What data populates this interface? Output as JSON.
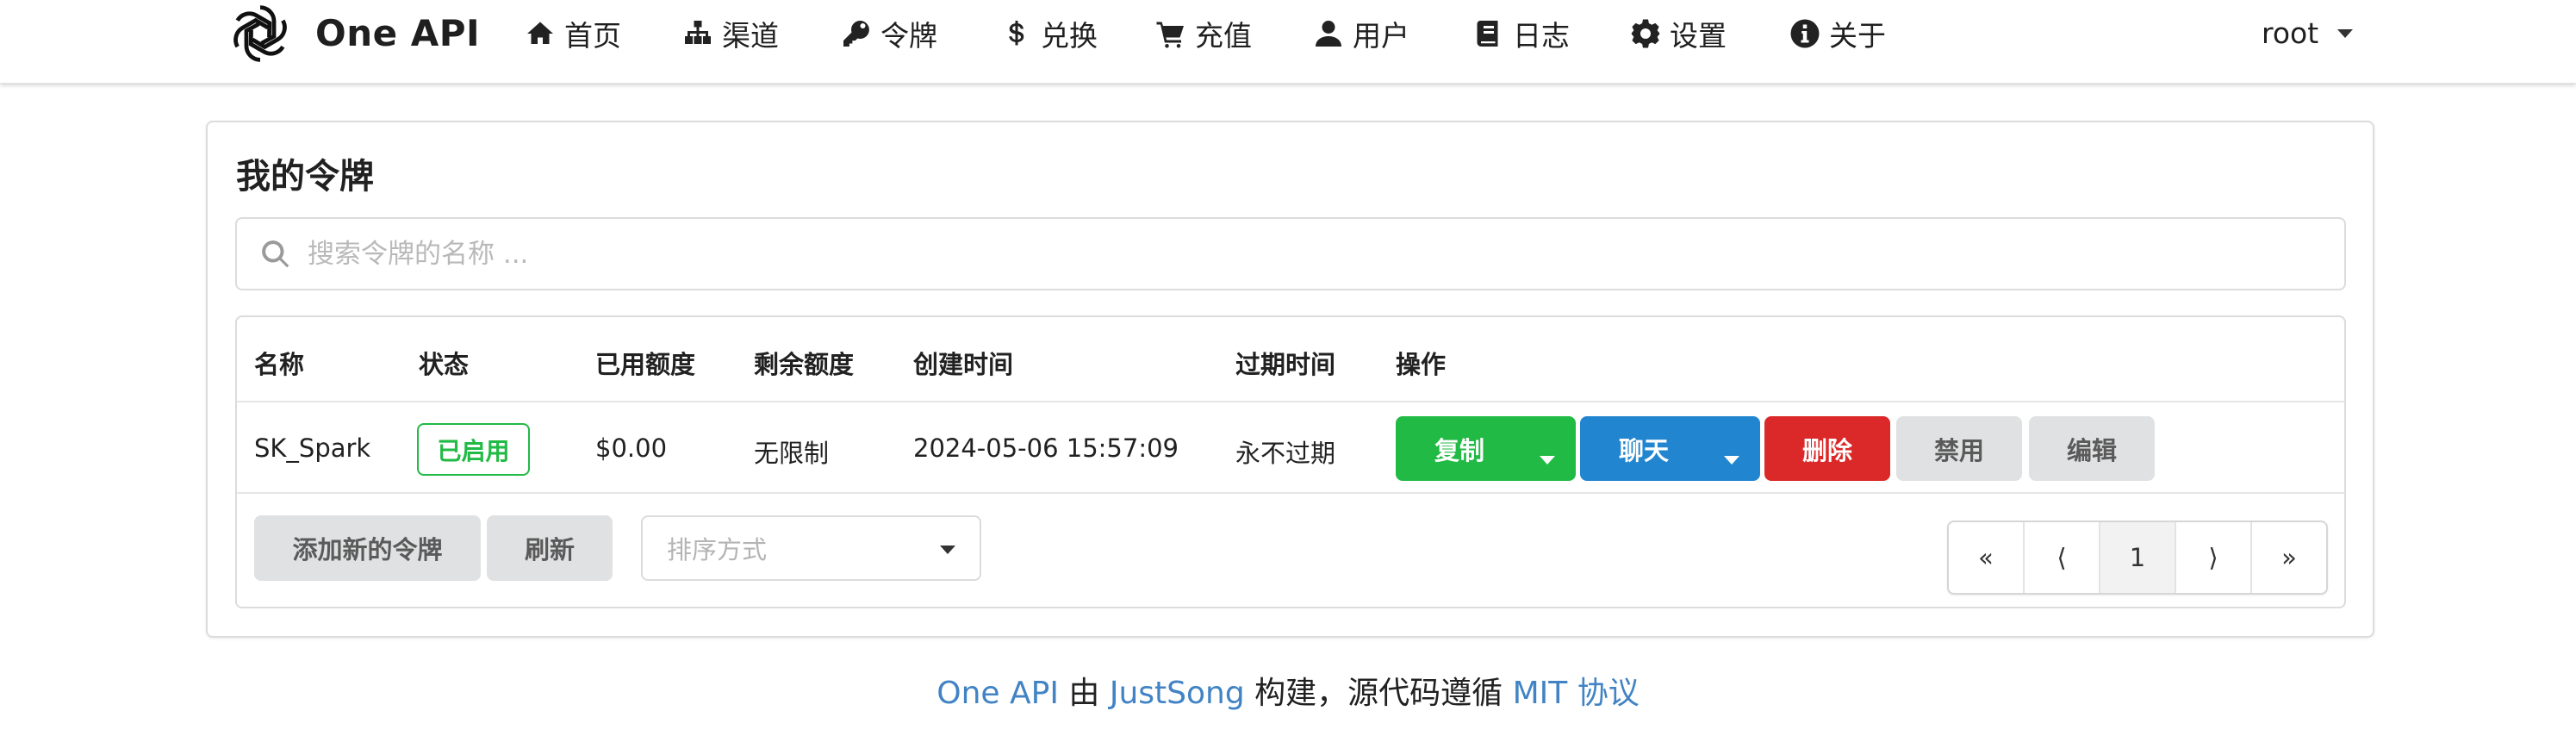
{
  "brand": {
    "name": "One API"
  },
  "nav": [
    {
      "label": "首页",
      "icon": "home-icon"
    },
    {
      "label": "渠道",
      "icon": "sitemap-icon"
    },
    {
      "label": "令牌",
      "icon": "key-icon"
    },
    {
      "label": "兑换",
      "icon": "dollar-icon"
    },
    {
      "label": "充值",
      "icon": "cart-icon"
    },
    {
      "label": "用户",
      "icon": "user-icon"
    },
    {
      "label": "日志",
      "icon": "book-icon"
    },
    {
      "label": "设置",
      "icon": "gear-icon"
    },
    {
      "label": "关于",
      "icon": "info-circle-icon"
    }
  ],
  "user": {
    "name": "root"
  },
  "page": {
    "title": "我的令牌",
    "search_placeholder": "搜索令牌的名称 ..."
  },
  "table": {
    "headers": [
      "名称",
      "状态",
      "已用额度",
      "剩余额度",
      "创建时间",
      "过期时间",
      "操作"
    ],
    "rows": [
      {
        "name": "SK_Spark",
        "status": "已启用",
        "used_quota": "$0.00",
        "remaining_quota": "无限制",
        "created_time": "2024-05-06 15:57:09",
        "expire_time": "永不过期",
        "actions": {
          "copy": "复制",
          "chat": "聊天",
          "delete": "删除",
          "disable": "禁用",
          "edit": "编辑"
        }
      }
    ]
  },
  "toolbar": {
    "add_label": "添加新的令牌",
    "refresh_label": "刷新",
    "sort_placeholder": "排序方式"
  },
  "pagination": {
    "first": "«",
    "prev": "⟨",
    "current": "1",
    "next": "⟩",
    "last": "»"
  },
  "footer": {
    "project": "One API",
    "by": " 由 ",
    "author": "JustSong",
    "middle": " 构建，源代码遵循 ",
    "license": "MIT 协议"
  },
  "colors": {
    "green": "#21ba45",
    "blue": "#2185d0",
    "red": "#db2828",
    "grey_button": "#e0e1e2",
    "link": "#4183c4"
  }
}
